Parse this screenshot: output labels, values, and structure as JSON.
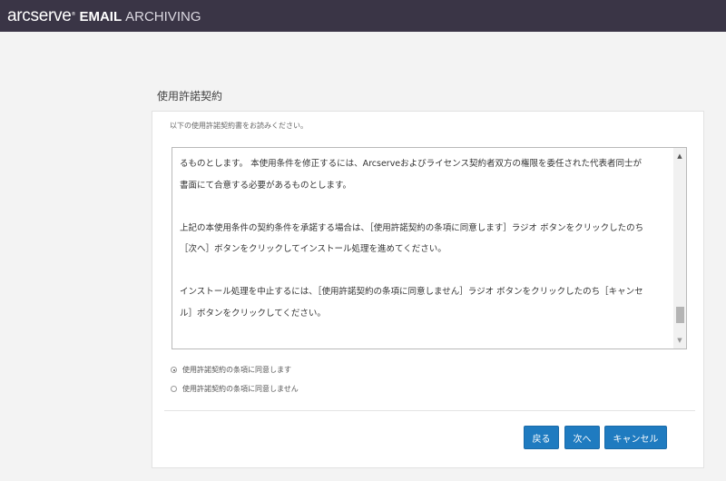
{
  "header": {
    "logo": "arcserve",
    "tm": "®",
    "product_bold": "EMAIL",
    "product_light": "ARCHIVING"
  },
  "page": {
    "title": "使用許諾契約",
    "instruction": "以下の使用許諾契約書をお読みください。"
  },
  "license": {
    "lines": [
      "るものとします。 本使用条件を修正するには、Arcserveおよびライセンス契約者双方の権限を委任された代表者同士が",
      "書面にて合意する必要があるものとします。",
      "",
      "上記の本使用条件の契約条件を承諾する場合は、［使用許諾契約の条項に同意します］ラジオ ボタンをクリックしたのち",
      "［次へ］ボタンをクリックしてインストール処理を進めてください。",
      "",
      "インストール処理を中止するには、［使用許諾契約の条項に同意しません］ラジオ ボタンをクリックしたのち［キャンセ",
      "ル］ボタンをクリックしてください。"
    ],
    "scroll_position": 0.93
  },
  "options": {
    "accept_label": "使用許諾契約の条項に同意します",
    "decline_label": "使用許諾契約の条項に同意しません",
    "selected": "accept"
  },
  "buttons": {
    "back": "戻る",
    "next": "次へ",
    "cancel": "キャンセル"
  },
  "colors": {
    "header_bg": "#3a3546",
    "button_bg": "#1f7bc0"
  }
}
